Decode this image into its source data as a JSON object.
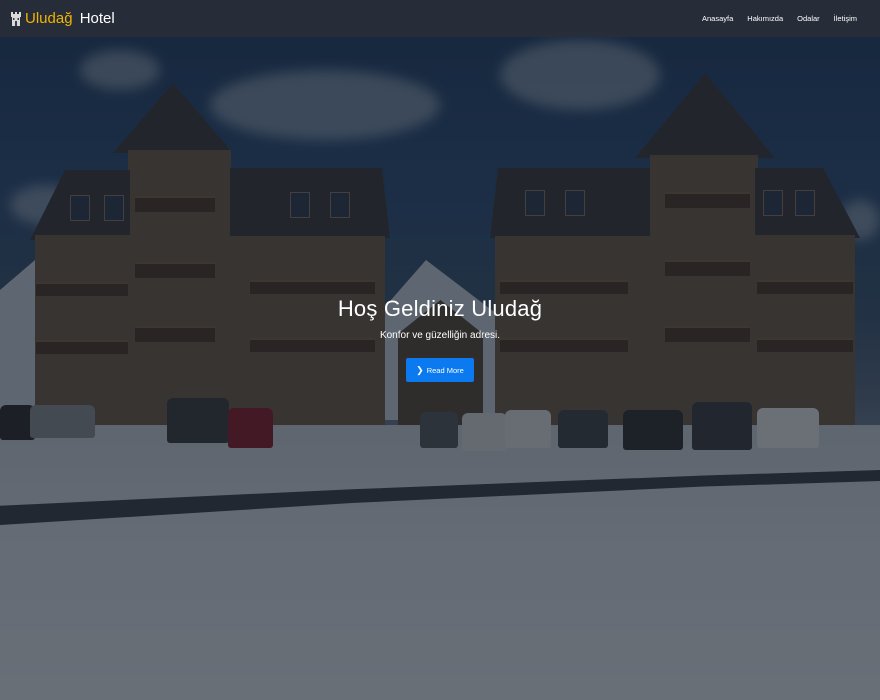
{
  "brand": {
    "accent": "Uludağ",
    "rest": " Hotel",
    "icon": "castle-icon"
  },
  "nav": {
    "items": [
      {
        "label": "Anasayfa"
      },
      {
        "label": "Hakımızda"
      },
      {
        "label": "Odalar"
      },
      {
        "label": "İletişim"
      }
    ]
  },
  "hero": {
    "title": "Hoş Geldiniz Uludağ",
    "subtitle": "Konfor ve güzelliğin adresi.",
    "button_label": "Read More",
    "button_icon": "chevron-right-icon"
  },
  "colors": {
    "accent": "#f0b400",
    "button": "#0b7af0",
    "navbar": "#282e38"
  }
}
